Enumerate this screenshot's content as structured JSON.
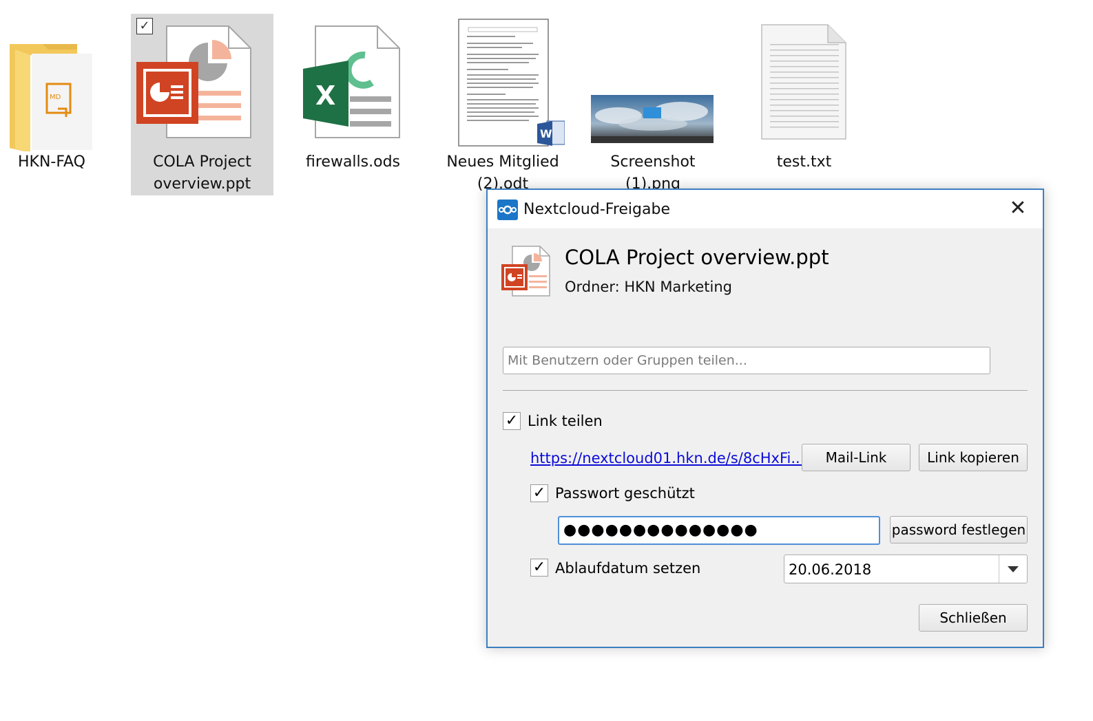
{
  "desktop": {
    "files": [
      {
        "label": "HKN-FAQ",
        "type": "folder"
      },
      {
        "label": "COLA Project overview.ppt",
        "type": "powerpoint",
        "selected": true
      },
      {
        "label": "firewalls.ods",
        "type": "spreadsheet"
      },
      {
        "label": "Neues Mitglied (2).odt",
        "type": "word-document"
      },
      {
        "label": "Screenshot (1).png",
        "type": "image"
      },
      {
        "label": "test.txt",
        "type": "text"
      }
    ],
    "selected_check": "✓"
  },
  "dialog": {
    "title": "Nextcloud-Freigabe",
    "close_glyph": "✕",
    "file_name": "COLA Project overview.ppt",
    "folder": "Ordner: HKN Marketing",
    "share_placeholder": "Mit Benutzern oder Gruppen teilen...",
    "share_link": {
      "label": "Link teilen",
      "checked": true,
      "check_glyph": "✓"
    },
    "link_url": "https://nextcloud01.hkn.de/s/8cHxFi...",
    "mail_link_button": "Mail-Link",
    "copy_link_button": "Link kopieren",
    "password_protected": {
      "label": "Passwort geschützt",
      "checked": true,
      "check_glyph": "✓"
    },
    "password_value": "●●●●●●●●●●●●●●",
    "set_password_button": "password festlegen",
    "expiry": {
      "label": "Ablaufdatum setzen",
      "checked": true,
      "check_glyph": "✓"
    },
    "expiry_date": "20.06.2018",
    "close_button": "Schließen"
  },
  "colors": {
    "dialog_border": "#3c7fc1",
    "nextcloud_blue": "#1b76c8",
    "powerpoint_red": "#d04423",
    "excel_green": "#1e7145",
    "word_blue": "#2b579a",
    "folder_yellow": "#f8d775",
    "link_blue": "#0b0bd8"
  }
}
